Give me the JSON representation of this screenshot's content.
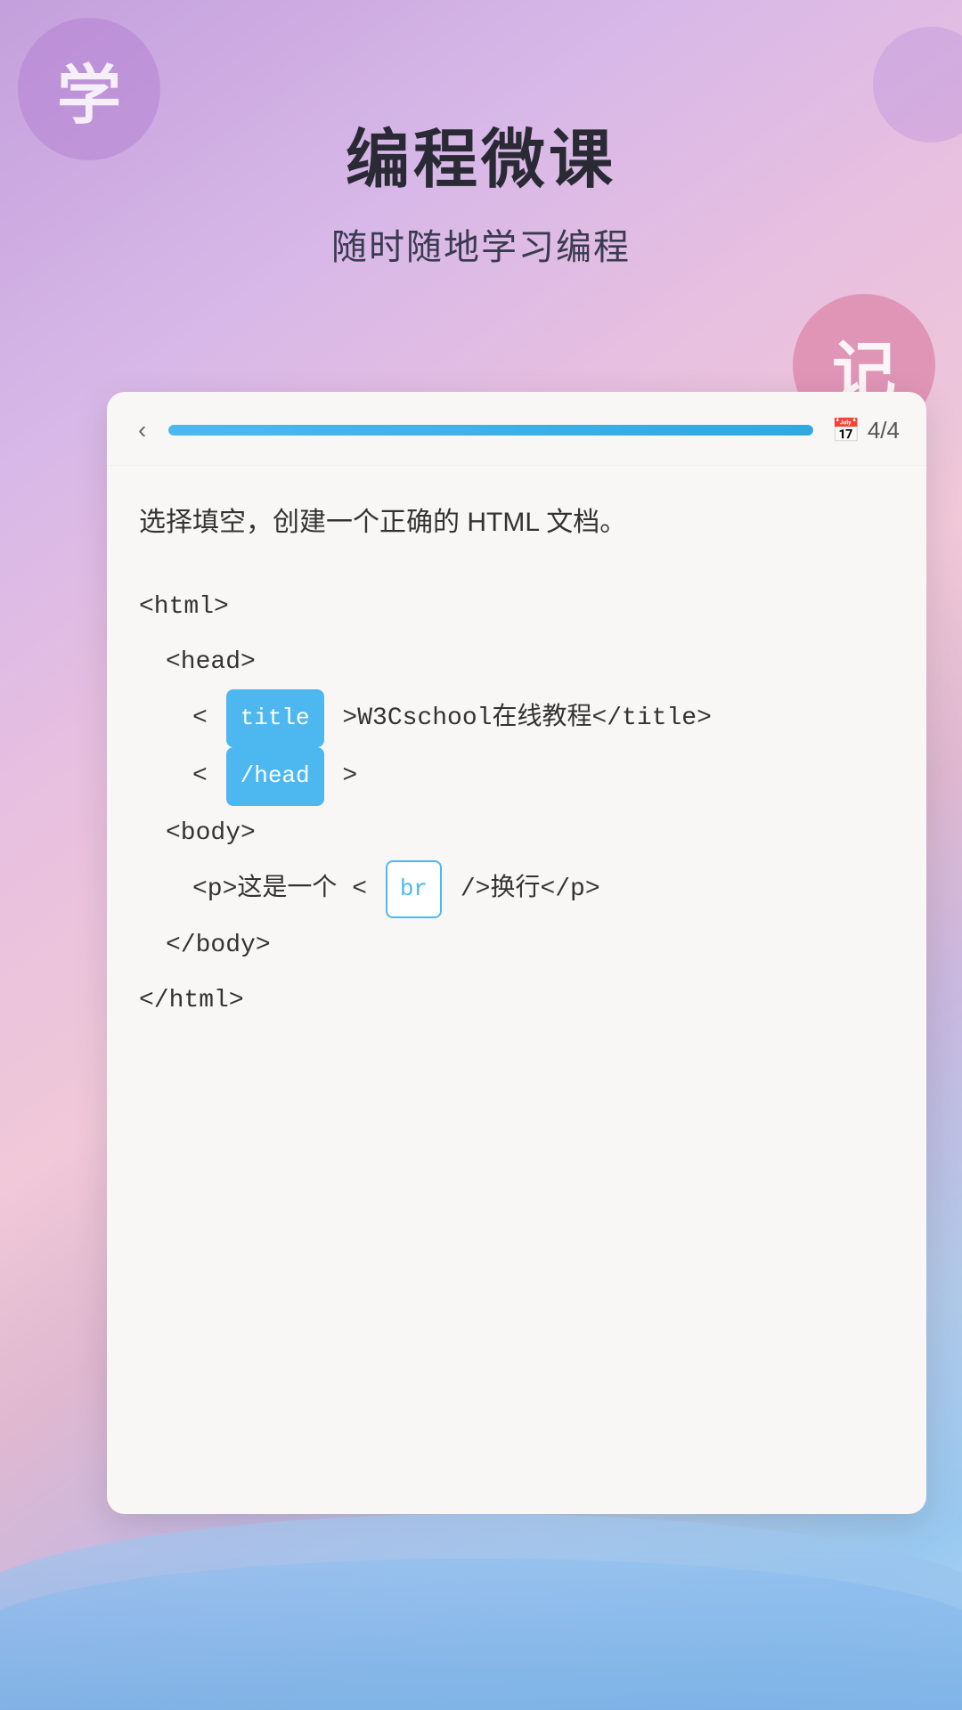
{
  "background": {
    "gradient": "linear-gradient(145deg, #c4a0dc, #d8b8e8, #e8c0e0, #f0c8d8, #e0b8d0, #c8b8e0, #b0c8e8, #98c8f0, #b0d8f8)"
  },
  "decorations": {
    "circle_xue_label": "学",
    "circle_ji_label": "记"
  },
  "header": {
    "main_title": "编程微课",
    "sub_title": "随时随地学习编程"
  },
  "card": {
    "back_button_label": "‹",
    "progress": 100,
    "page_counter": "4/4",
    "calendar_icon": "⊡",
    "instruction": "选择填空，创建一个正确的 HTML 文档。",
    "code_lines": [
      {
        "indent": 0,
        "content": "<html>"
      },
      {
        "indent": 1,
        "content": "<head>"
      },
      {
        "indent": 2,
        "type": "blank_line",
        "prefix": "< ",
        "blank": "title",
        "suffix": " >W3Cschool在线教程</title>",
        "blank_selected": false
      },
      {
        "indent": 2,
        "type": "blank_line2",
        "prefix": "< ",
        "blank": "/head",
        "suffix": " >",
        "blank_selected": false
      },
      {
        "indent": 1,
        "content": "<body>"
      },
      {
        "indent": 2,
        "type": "blank_line3",
        "prefix": "<p>这是一个 < ",
        "blank": "br",
        "suffix": " />换行</p>",
        "blank_selected": false
      },
      {
        "indent": 1,
        "content": "</body>"
      },
      {
        "indent": 0,
        "content": "</html>"
      }
    ]
  }
}
